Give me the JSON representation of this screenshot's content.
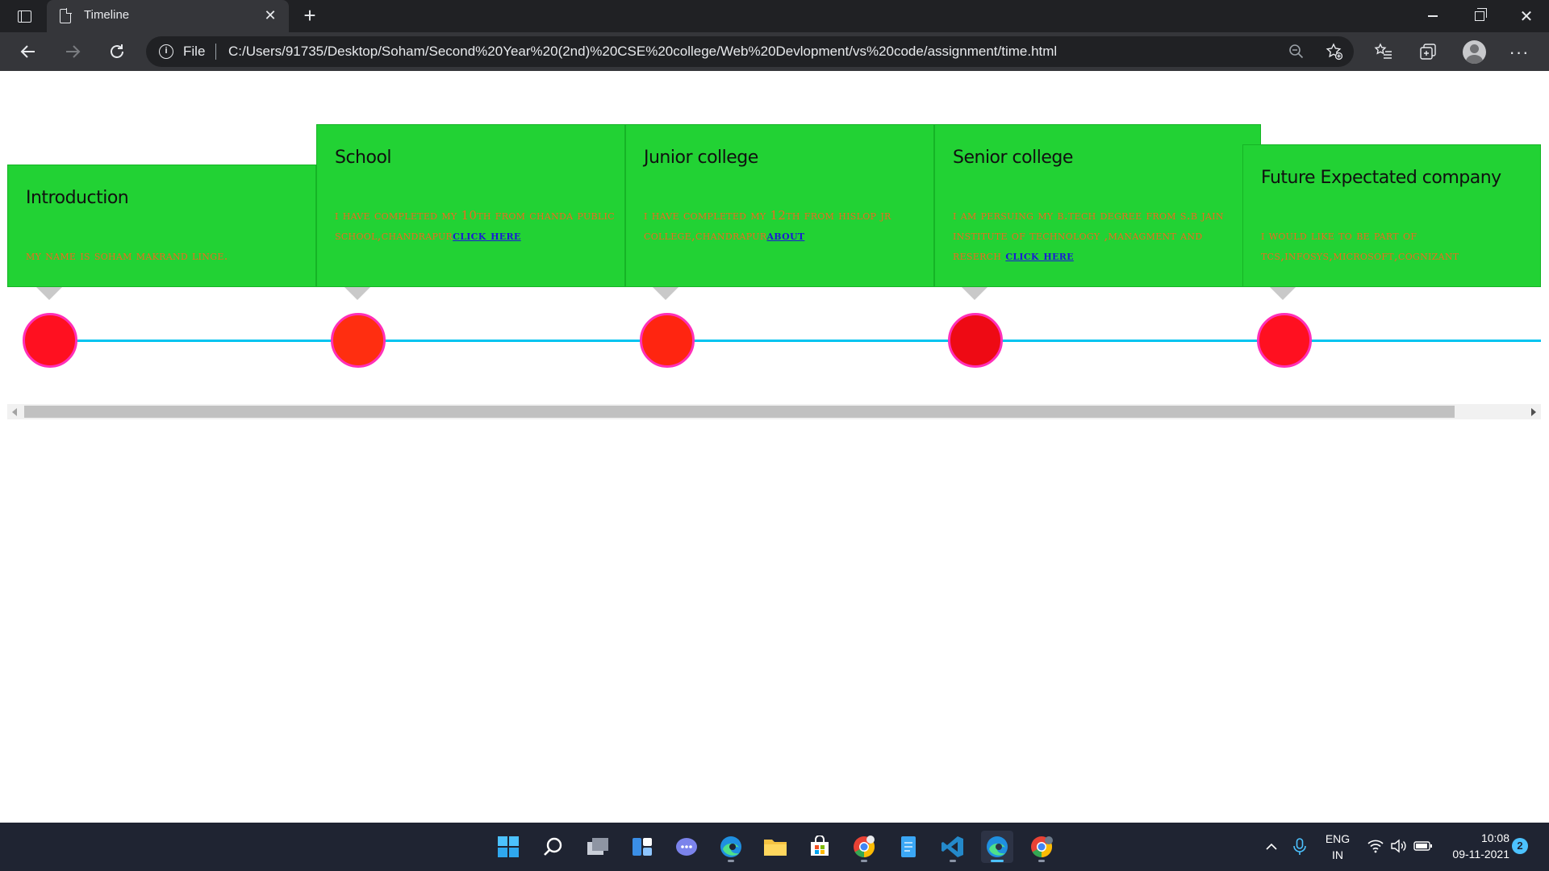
{
  "browser": {
    "tab_title": "Timeline",
    "tab_close": "✕",
    "new_tab": "+",
    "file_label": "File",
    "url": "C:/Users/91735/Desktop/Soham/Second%20Year%20(2nd)%20CSE%20college/Web%20Devlopment/vs%20code/assignment/time.html",
    "icons": {
      "back": "arrow-left-icon",
      "forward": "arrow-right-icon",
      "reload": "reload-icon",
      "info": "info-icon",
      "zoom": "zoom-out-icon",
      "add_favorite": "star-plus-icon",
      "favorites": "favorites-list-icon",
      "collections": "collections-icon",
      "profile": "profile-avatar-icon",
      "more": "more-ellipsis-icon"
    }
  },
  "timeline": {
    "line_color": "#00c4f0",
    "card_color": "#22d234",
    "items": [
      {
        "title": "Introduction",
        "text": "My name is Soham makrand LINGE.",
        "link": "",
        "dot_color": "#ff1020"
      },
      {
        "title": "School",
        "text": "I have completed my 10th from chanda public school,chandrapur",
        "link": "Click Here",
        "dot_color": "#ff2e10"
      },
      {
        "title": "Junior college",
        "text": "I have completed my 12th from Hislop Jr college,Chandrapur",
        "link": "about",
        "dot_color": "#ff2510"
      },
      {
        "title": "Senior college",
        "text": "I am persuing my B.tech degree From S.b Jain Institute of Technology ,Managment and Reserch ",
        "link": "Click here",
        "dot_color": "#ee0a14"
      },
      {
        "title": "Future Expectated company",
        "text": "I would like to be part of TCS,Infosys,Microsoft,Cognizant",
        "link": "",
        "dot_color": "#ff1020"
      }
    ]
  },
  "taskbar": {
    "apps": [
      "windows-start-icon",
      "search-icon",
      "task-view-icon",
      "widgets-icon",
      "teams-chat-icon",
      "edge-icon",
      "file-explorer-icon",
      "microsoft-store-icon",
      "chrome-icon",
      "notepad-icon",
      "vscode-icon",
      "edge-active-icon",
      "chrome-profile-icon"
    ],
    "lang_top": "ENG",
    "lang_bottom": "IN",
    "time": "10:08",
    "date": "09-11-2021",
    "notifications": "2"
  }
}
